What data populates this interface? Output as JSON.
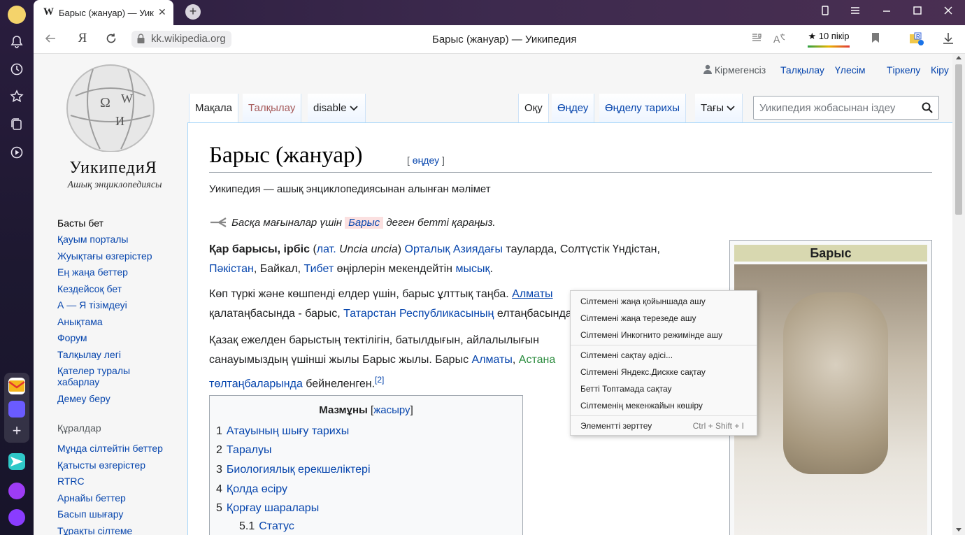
{
  "browser": {
    "tab_title": "Барыс (жануар) — Уикипедия",
    "tab_favicon": "W",
    "tab_close": "✕",
    "new_tab": "+",
    "address": "kk.wikipedia.org",
    "page_title": "Барыс (жануар) — Уикипедия",
    "reviews": "★ 10 пікір",
    "ya": "Я"
  },
  "wiki": {
    "logo_title": "УикипедиЯ",
    "logo_sub": "Ашық энциклопедиясы",
    "user": {
      "anon": "Кірмегенсіз",
      "talk": "Талқылау",
      "contrib": "Үлесім",
      "register": "Тіркелу",
      "login": "Кіру"
    },
    "tabs": {
      "article": "Мақала",
      "talk": "Талқылау",
      "variant": "disable",
      "read": "Оқу",
      "edit": "Өңдеу",
      "history": "Өңделу тарихы",
      "more": "Тағы"
    },
    "search_placeholder": "Уикипедия жобасынан іздеу",
    "nav": [
      "Басты бет",
      "Қауым порталы",
      "Жуықтағы өзгерістер",
      "Ең жаңа беттер",
      "Кездейсоқ бет",
      "А — Я тізімдеуі",
      "Анықтама",
      "Форум",
      "Талқылау легі",
      "Қателер туралы",
      "хабарлау",
      "Демеу беру"
    ],
    "tools_heading": "Құралдар",
    "tools": [
      "Мұнда сілтейтін беттер",
      "Қатысты өзгерістер",
      "RTRC",
      "Арнайы беттер",
      "Басып шығару",
      "Тұрақты сілтеме"
    ]
  },
  "article": {
    "title": "Барыс (жануар)",
    "edit_label": "өңдеу",
    "edit_open": "[ ",
    "edit_close": " ]",
    "source": "Уикипедия — ашық энциклопедиясынан алынған мәлімет",
    "hatnote_pre": "Басқа мағыналар үшін",
    "hatnote_link": "Барыс",
    "hatnote_post": "деген бетті қараңыз.",
    "p1_l1_bold": "Қар барысы, ірбіс",
    "p1_l1_open": " (",
    "p1_l1_lat": "лат.",
    "p1_l1_sp": " Uncia uncia",
    "p1_l1_close": ") ",
    "p1_l1_link2": "Орталық Азиядағы",
    "p1_l1_rest": " тауларда, Солтүстік Үндістан,",
    "p1_l2_link1": "Пәкістан",
    "p1_l2_t1": ", Байкал, ",
    "p1_l2_link2": "Тибет",
    "p1_l2_t2": " өңірлерін мекендейтін ",
    "p1_l2_link3": "мысық",
    "p1_l2_t3": ".",
    "p2_l1_text": "Көп түркі және көшпенді елдер үшін, барыс ұлттық таңба. ",
    "p2_l1_link": "Алматы",
    "p2_l2_t1": "қалатаңбасында - барыс, ",
    "p2_l2_link": "Татарстан Республикасының",
    "p2_l2_t2": " елтаңбасында",
    "p3_l1": "Қазақ ежелден барыстың тектілігін, батылдығын, айлалылығын",
    "p3_l2_t1": "санауымыздың үшінші жылы Барыс жылы. Барыс ",
    "p3_l2_link1": "Алматы",
    "p3_l2_t2": ", ",
    "p3_l2_link2": "Астана",
    "p3_l3_link": "төлтаңбаларында",
    "p3_l3_t": " бейнеленген.",
    "p3_ref": "[2]"
  },
  "infobox": {
    "title": "Барыс"
  },
  "toc": {
    "title": "Мазмұны",
    "hide": "жасыру",
    "items": [
      {
        "num": "1",
        "label": "Атауының шығу тарихы"
      },
      {
        "num": "2",
        "label": "Таралуы"
      },
      {
        "num": "3",
        "label": "Биологиялық ерекшеліктері"
      },
      {
        "num": "4",
        "label": "Қолда өсіру"
      },
      {
        "num": "5",
        "label": "Қорғау шаралары"
      },
      {
        "num": "5.1",
        "label": "Статус"
      }
    ]
  },
  "context_menu": {
    "items": [
      "Сілтемені жаңа қойыншада ашу",
      "Сілтемені жаңа терезеде ашу",
      "Сілтемені Инкогнито режимінде ашу",
      "Сілтемені сақтау әдісі...",
      "Сілтемені Яндекс.Дискке сақтау",
      "Бетті Топтамада сақтау",
      "Сілтеменің мекенжайын көшіру",
      "Элементті зерттеу"
    ],
    "inspect_shortcut": "Ctrl + Shift + I"
  }
}
